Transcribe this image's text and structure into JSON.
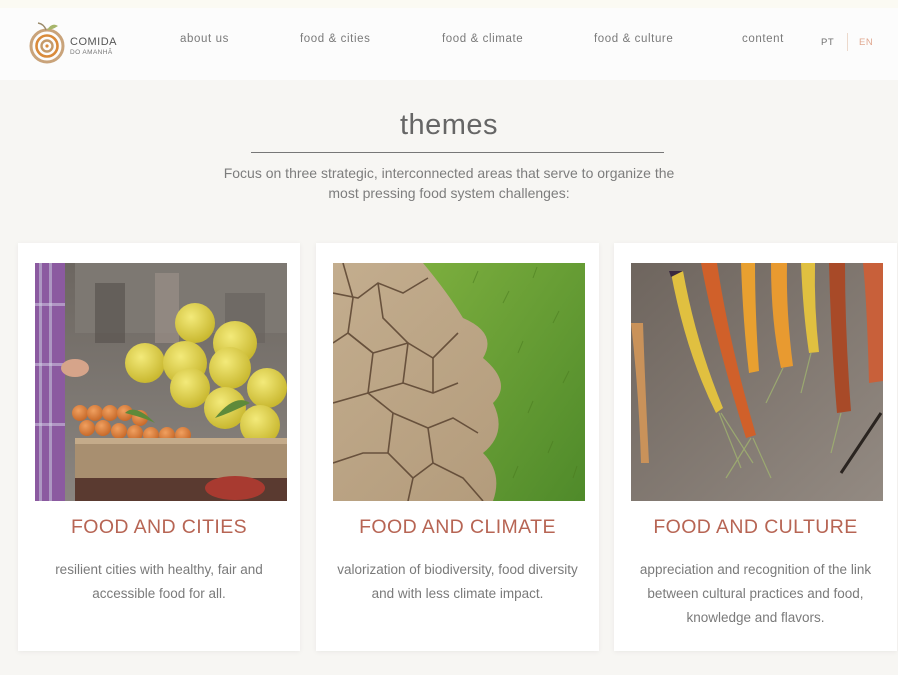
{
  "brand": {
    "name_line1": "COMIDA",
    "name_line2": "DO AMANHÃ",
    "logo_icon": "spiral-fruit-icon"
  },
  "nav": {
    "items": [
      {
        "label": "about us"
      },
      {
        "label": "food & cities"
      },
      {
        "label": "food & climate"
      },
      {
        "label": "food & culture"
      },
      {
        "label": "content"
      }
    ],
    "languages": [
      {
        "label": "PT",
        "active": false
      },
      {
        "label": "EN",
        "active": true
      }
    ]
  },
  "hero": {
    "title": "themes",
    "intro_line1": "Focus on three strategic, interconnected areas that serve to organize the",
    "intro_line2": "most pressing food system challenges:"
  },
  "cards": [
    {
      "title": "FOOD AND CITIES",
      "line1": "resilient cities with healthy, fair and",
      "line2": "accessible food for all.",
      "line3": "",
      "image": "fruit-crate-market-photo"
    },
    {
      "title": "FOOD AND CLIMATE",
      "line1": "valorization of biodiversity, food diversity",
      "line2": "and with less climate impact.",
      "line3": "",
      "image": "cracked-earth-and-grass-photo"
    },
    {
      "title": "FOOD AND CULTURE",
      "line1": "appreciation and recognition of the link",
      "line2": "between cultural practices and food,",
      "line3": "knowledge and flavors.",
      "image": "colorful-carrots-photo"
    }
  ],
  "colors": {
    "accent": "#b76554",
    "logo_orange": "#d98a3a",
    "text": "#7a7a7a",
    "background": "#f7f6f3"
  }
}
